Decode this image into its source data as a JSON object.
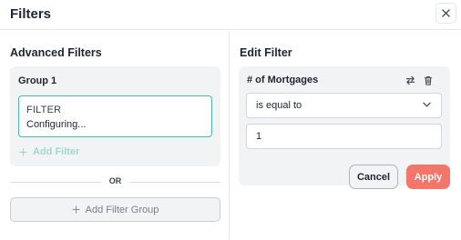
{
  "header": {
    "title": "Filters",
    "close_icon": "close-icon"
  },
  "left": {
    "title": "Advanced Filters",
    "group": {
      "title": "Group 1",
      "filter": {
        "label": "FILTER",
        "status": "Configuring..."
      },
      "add_filter_label": "Add Filter"
    },
    "or_label": "OR",
    "add_group_label": "Add Filter Group"
  },
  "right": {
    "title": "Edit Filter",
    "field_name": "# of Mortgages",
    "operator": "is equal to",
    "value": "1",
    "cancel_label": "Cancel",
    "apply_label": "Apply"
  },
  "colors": {
    "accent_teal": "#4fb9ac",
    "accent_teal_muted": "#9fd8cf",
    "apply_coral": "#f4756a",
    "panel_gray": "#f2f3f5"
  }
}
